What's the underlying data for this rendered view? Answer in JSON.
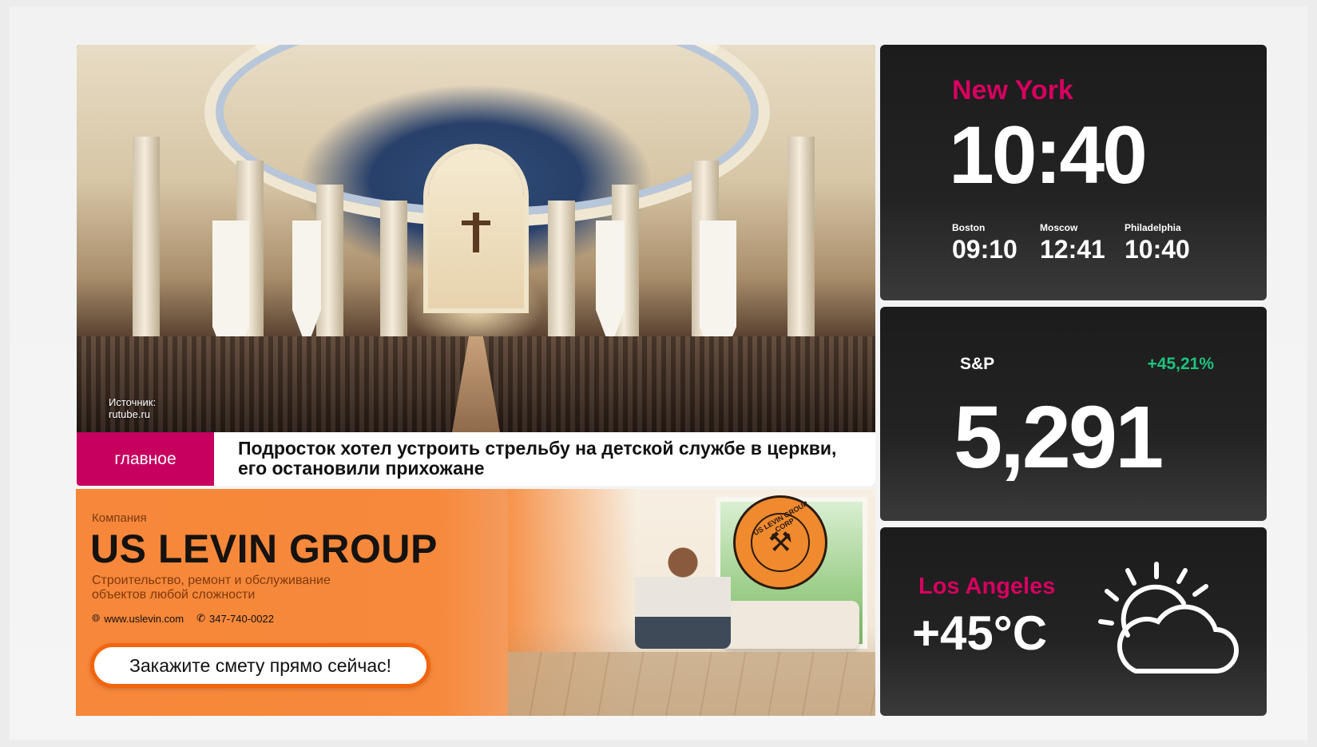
{
  "news": {
    "source": [
      "Источник:",
      "rutube.ru"
    ],
    "tag": "главное",
    "headline": "Подросток хотел устроить стрельбу на детской службе в церкви, его остановили прихожане"
  },
  "ad": {
    "company_label": "Компания",
    "company_name": "US LEVIN GROUP",
    "description": "Строительство, ремонт и обслуживание объектов любой сложности",
    "website": "www.uslevin.com",
    "phone": "347-740-0022",
    "cta": "Закажите смету прямо сейчас!",
    "seal_text": "US LEVIN GROUP CORP"
  },
  "clock": {
    "main_city": "New York",
    "main_time": "10:40",
    "others": [
      {
        "city": "Boston",
        "time": "09:10"
      },
      {
        "city": "Moscow",
        "time": "12:41"
      },
      {
        "city": "Philadelphia",
        "time": "10:40"
      }
    ]
  },
  "stock": {
    "name": "S&P",
    "change": "+45,21%",
    "value": "5,291"
  },
  "weather": {
    "city": "Los Angeles",
    "temp": "+45°C",
    "icon": "partly-cloudy-icon"
  },
  "colors": {
    "accent": "#d6005f",
    "tag_bg": "#c7005f",
    "positive": "#1ec27f",
    "ad_orange": "#f6893b"
  }
}
